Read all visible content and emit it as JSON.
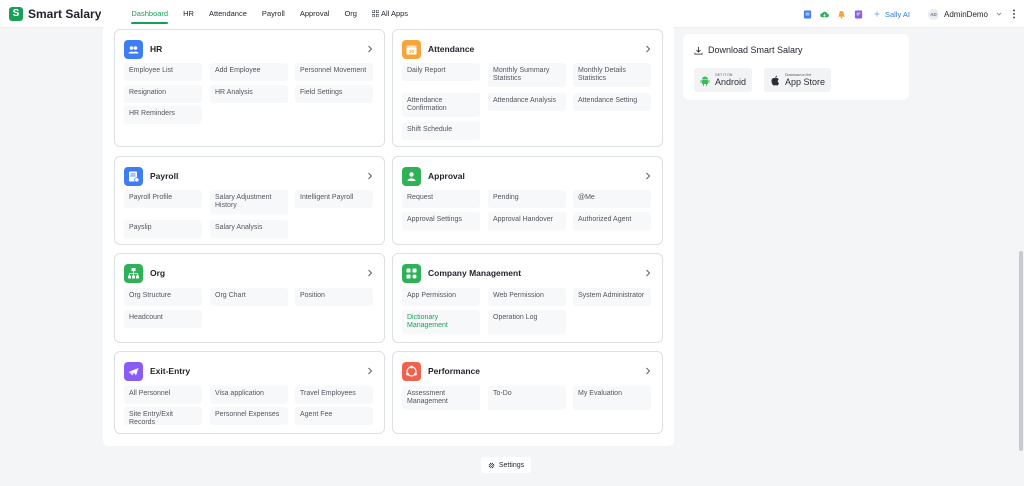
{
  "app": {
    "name": "Smart Salary",
    "logo_letter": "S",
    "brand_color": "#18a058"
  },
  "nav": {
    "items": [
      {
        "label": "Dashboard"
      },
      {
        "label": "HR"
      },
      {
        "label": "Attendance"
      },
      {
        "label": "Payroll"
      },
      {
        "label": "Approval"
      },
      {
        "label": "Org"
      },
      {
        "label": "All Apps"
      }
    ]
  },
  "toolbar": {
    "sally_label": "Sally AI"
  },
  "user": {
    "initials": "AD",
    "name": "AdminDemo"
  },
  "cards": {
    "hr": {
      "title": "HR",
      "items": [
        "Employee List",
        "Add Employee",
        "Personnel Movement",
        "Resignation",
        "HR Analysis",
        "Field Settings",
        "HR Reminders"
      ]
    },
    "attendance": {
      "title": "Attendance",
      "icon_text": "30",
      "items": [
        "Daily Report",
        "Monthly Summary Statistics",
        "Monthly Details Statistics",
        "Attendance Confirmation",
        "Attendance Analysis",
        "Attendance Setting",
        "Shift Schedule"
      ]
    },
    "payroll": {
      "title": "Payroll",
      "items": [
        "Payroll Profile",
        "Salary Adjustment History",
        "Intelligent Payroll",
        "Payslip",
        "Salary Analysis"
      ]
    },
    "approval": {
      "title": "Approval",
      "items": [
        "Request",
        "Pending",
        "@Me",
        "Approval Settings",
        "Approval Handover",
        "Authorized Agent"
      ]
    },
    "org": {
      "title": "Org",
      "items": [
        "Org Structure",
        "Org Chart",
        "Position",
        "Headcount"
      ]
    },
    "company": {
      "title": "Company Management",
      "items": [
        "App Permission",
        "Web Permission",
        "System Administrator",
        "Dictionary Management",
        "Operation Log"
      ]
    },
    "exit_entry": {
      "title": "Exit-Entry",
      "items": [
        "All Personnel",
        "Visa application",
        "Travel Employees",
        "Site Entry/Exit Records",
        "Personnel Expenses",
        "Agent Fee"
      ]
    },
    "performance": {
      "title": "Performance",
      "items": [
        "Assessment Management",
        "To-Do",
        "My Evaluation"
      ]
    }
  },
  "download": {
    "title": "Download Smart Salary",
    "android_small": "GET IT ON",
    "android_big": "Android",
    "appstore_small": "Download on the",
    "appstore_big": "App Store"
  },
  "settings_label": "Settings",
  "colors": {
    "hr": "#3d7ef7",
    "attendance": "#f6a53a",
    "payroll": "#3d7ef7",
    "approval": "#2fb158",
    "org": "#2fb158",
    "company": "#2fb158",
    "exit_entry": "#8a5cf6",
    "performance": "#f0624d"
  }
}
